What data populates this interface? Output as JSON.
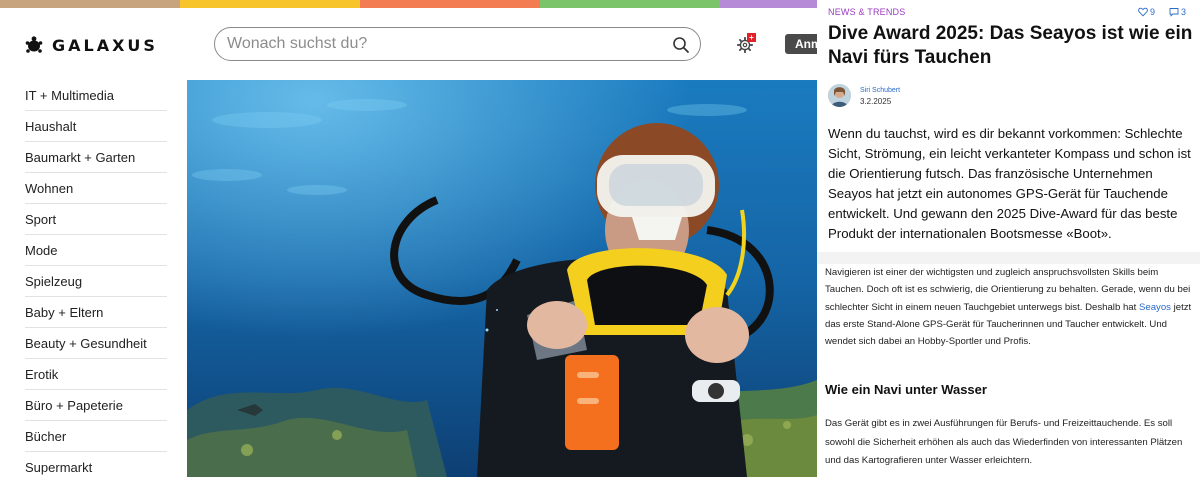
{
  "shop": {
    "brand": "GALAXUS",
    "stripe_colors": [
      "#c7a37e",
      "#f7c52b",
      "#f47c53",
      "#7cc46a",
      "#b68ad7"
    ],
    "search_placeholder": "Wonach suchst du?",
    "login_label": "Anmelden",
    "notification_badge": "+",
    "categories": [
      "IT + Multimedia",
      "Haushalt",
      "Baumarkt + Garten",
      "Wohnen",
      "Sport",
      "Mode",
      "Spielzeug",
      "Baby + Eltern",
      "Beauty + Gesundheit",
      "Erotik",
      "Büro + Papeterie",
      "Bücher",
      "Supermarkt"
    ]
  },
  "article": {
    "kicker": "NEWS & TRENDS",
    "likes": "9",
    "comments": "3",
    "title": "Dive Award 2025: Das Seayos ist wie ein Navi fürs Tauchen",
    "author": "Siri Schubert",
    "date": "3.2.2025",
    "lead": "Wenn du tauchst, wird es dir bekannt vorkommen: Schlechte Sicht, Strömung, ein leicht verkanteter Kompass und schon ist die Orientierung futsch. Das französische Unternehmen Seayos hat jetzt ein autonomes GPS-Gerät für Tauchende entwickelt. Und gewann den 2025 Dive-Award für das beste Produkt der internationalen Bootsmesse «Boot».",
    "body1_before": "Navigieren ist einer der wichtigsten und zugleich anspruchsvollsten Skills beim Tauchen. Doch oft ist es schwierig, die Orientierung zu behalten. Gerade, wenn du bei schlechter Sicht in einem neuen Tauchgebiet unterwegs bist. Deshalb hat ",
    "body1_link": "Seayos",
    "body1_after": " jetzt das erste Stand-Alone GPS-Gerät für Taucherinnen und Taucher entwickelt. Und wendet sich dabei an Hobby-Sportler und Profis.",
    "subheading": "Wie ein Navi unter Wasser",
    "body2": "Das Gerät gibt es in zwei Ausführungen für Berufs- und Freizeittauchende. Es soll sowohl die Sicherheit erhöhen als auch das Wiederfinden von interessanten Plätzen und das Kartografieren unter Wasser erleichtern."
  },
  "colors": {
    "kicker": "#9a3bbf",
    "link": "#2a6cc7",
    "button": "#4a4a4a",
    "badge": "#e4212b"
  }
}
